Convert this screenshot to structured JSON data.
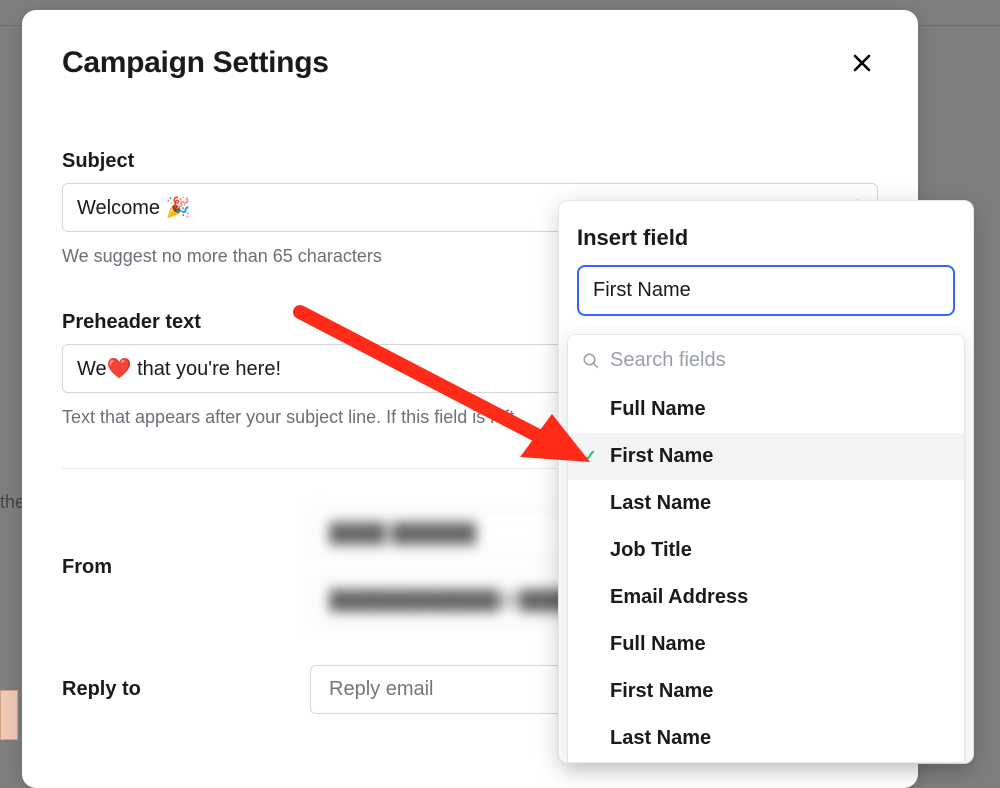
{
  "modal": {
    "title": "Campaign Settings"
  },
  "subject": {
    "label": "Subject",
    "value": "Welcome 🎉",
    "helper": "We suggest no more than 65 characters"
  },
  "preheader": {
    "label": "Preheader text",
    "value": "We❤️ that you're here!",
    "helper": "Text that appears after your subject line. If this field is left"
  },
  "from": {
    "label": "From",
    "name_placeholder": "████ ██████",
    "email_placeholder": "████████████@██████"
  },
  "reply_to": {
    "label": "Reply to",
    "placeholder": "Reply email"
  },
  "insert_field": {
    "title": "Insert field",
    "selected": "First Name",
    "search_placeholder": "Search fields",
    "options": [
      {
        "label": "Full Name",
        "selected": false
      },
      {
        "label": "First Name",
        "selected": true
      },
      {
        "label": "Last Name",
        "selected": false
      },
      {
        "label": "Job Title",
        "selected": false
      },
      {
        "label": "Email Address",
        "selected": false
      },
      {
        "label": "Full Name",
        "selected": false
      },
      {
        "label": "First Name",
        "selected": false
      },
      {
        "label": "Last Name",
        "selected": false
      }
    ]
  },
  "bg": {
    "left_text": "the"
  }
}
